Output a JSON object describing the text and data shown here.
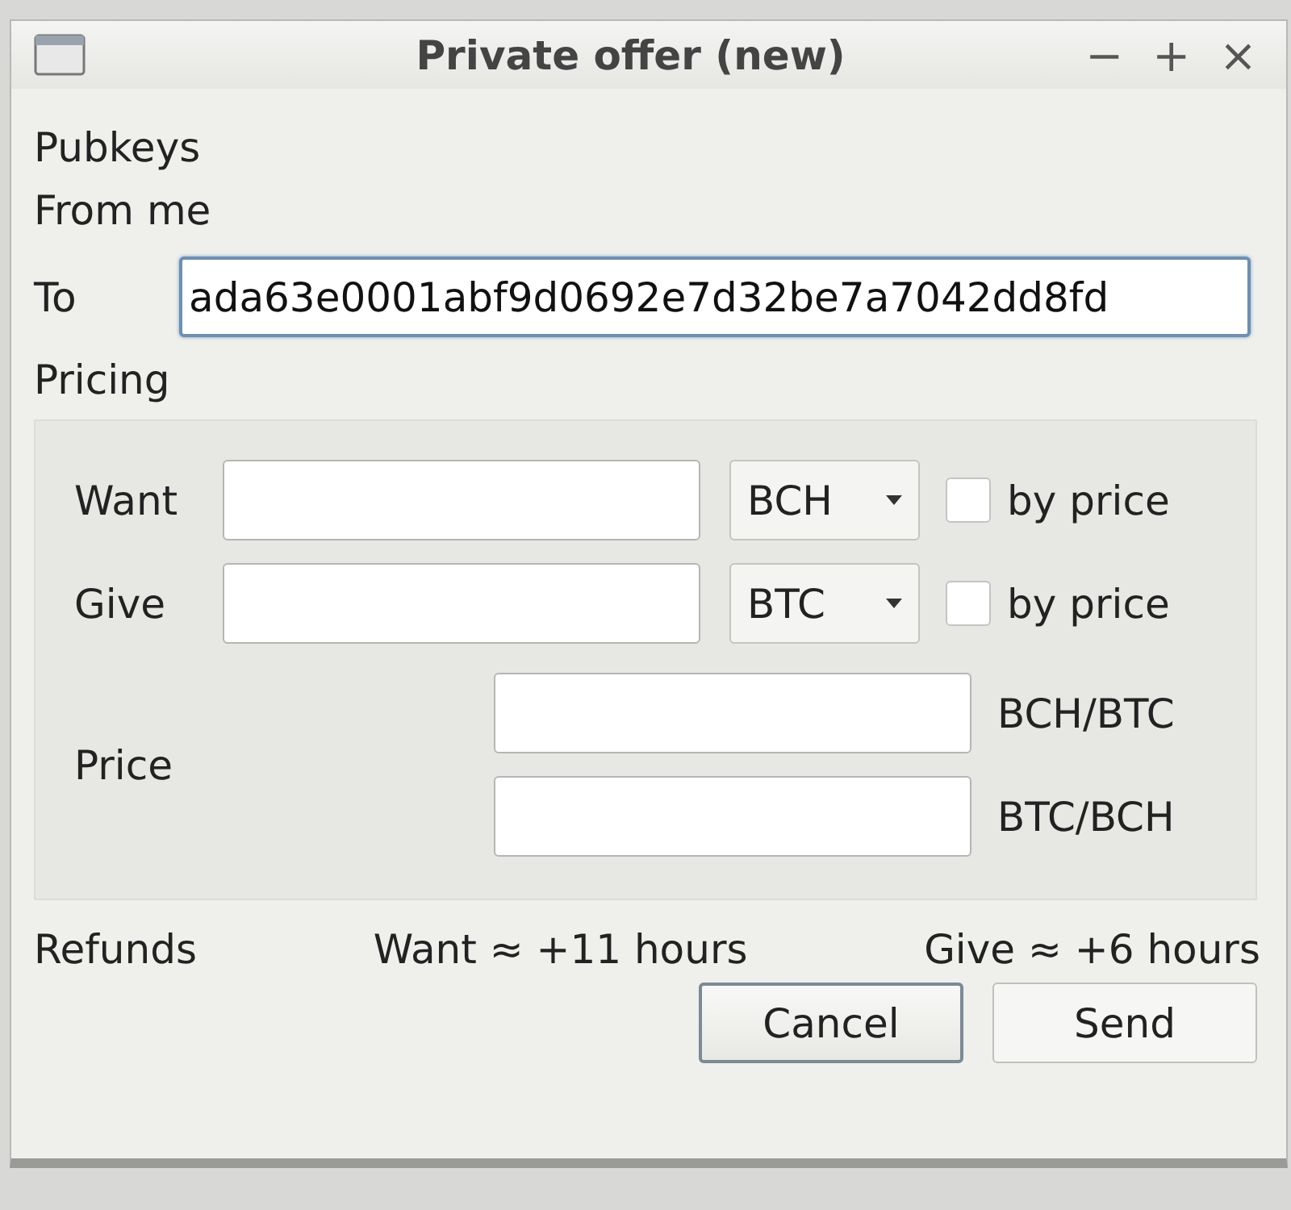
{
  "window": {
    "title": "Private offer (new)",
    "controls": [
      "−",
      "+",
      "×"
    ]
  },
  "pubkeys": {
    "heading": "Pubkeys",
    "from": {
      "label": "From",
      "value": "me"
    },
    "to": {
      "label": "To",
      "value": "ada63e0001abf9d0692e7d32be7a7042dd8fd",
      "focused": true
    }
  },
  "pricing": {
    "heading": "Pricing",
    "rows": [
      {
        "label": "Want",
        "currency": "BCH",
        "by_price": {
          "label": "by price",
          "checked": false
        }
      },
      {
        "label": "Give",
        "currency": "BTC",
        "by_price": {
          "label": "by price",
          "checked": false
        }
      }
    ],
    "price": {
      "label": "Price",
      "fields": [
        {
          "unit": "BCH/BTC"
        },
        {
          "unit": "BTC/BCH"
        }
      ]
    }
  },
  "refunds": {
    "label": "Refunds",
    "want": "Want ≈ +11 hours",
    "give": "Give ≈ +6 hours"
  },
  "buttons": [
    {
      "label": "Cancel",
      "focused": true
    },
    {
      "label": "Send",
      "focused": false
    }
  ]
}
